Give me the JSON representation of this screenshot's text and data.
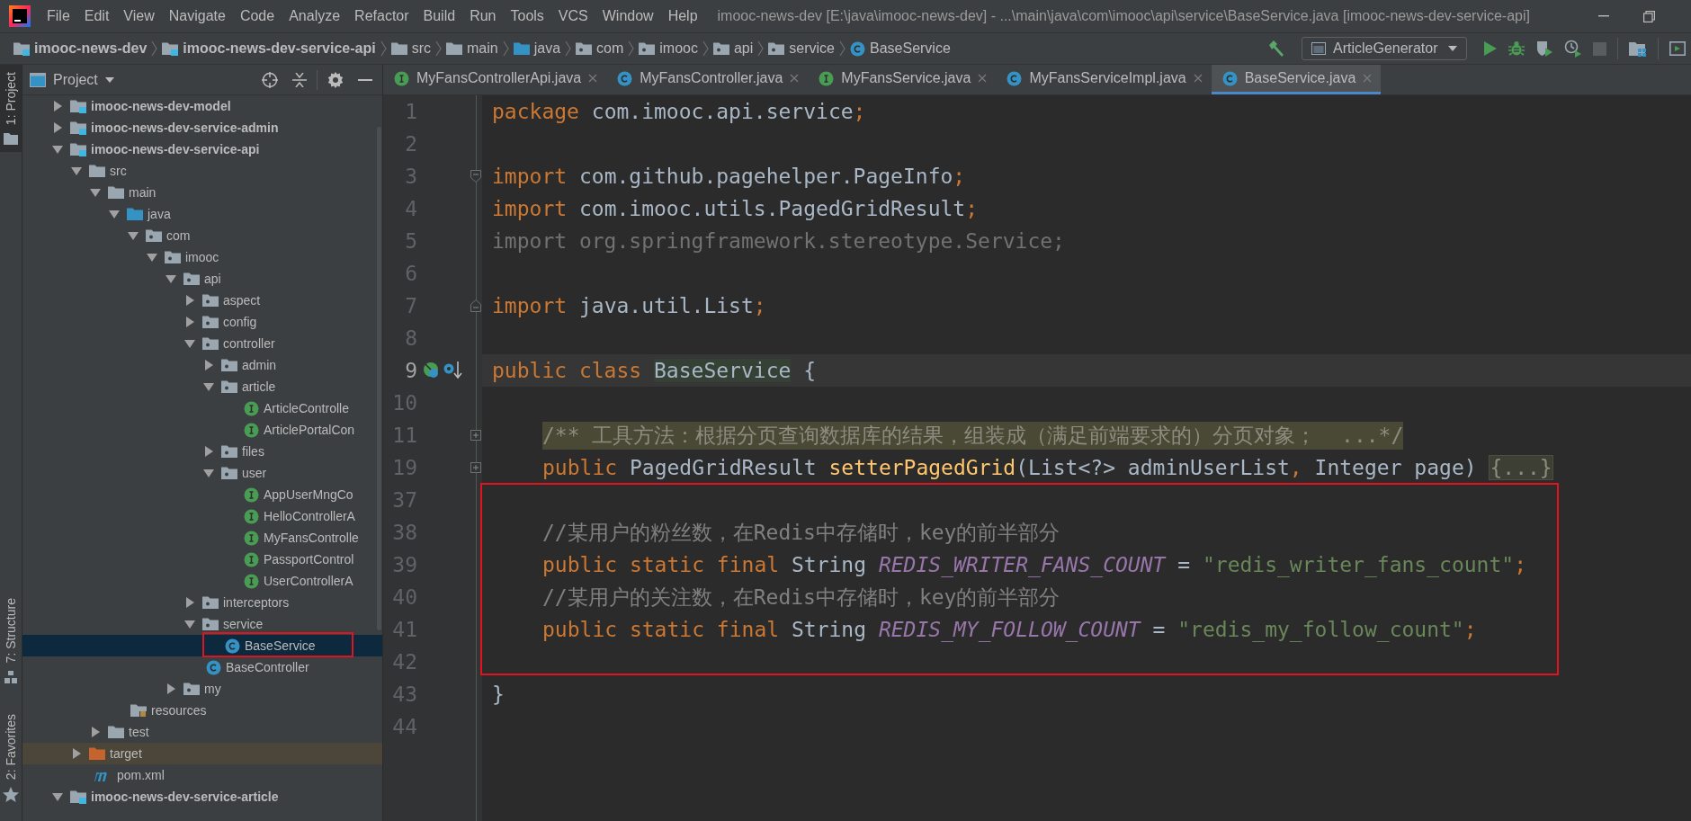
{
  "menu": {
    "items": [
      "File",
      "Edit",
      "View",
      "Navigate",
      "Code",
      "Analyze",
      "Refactor",
      "Build",
      "Run",
      "Tools",
      "VCS",
      "Window",
      "Help"
    ],
    "title": "imooc-news-dev [E:\\java\\imooc-news-dev] - ...\\main\\java\\com\\imooc\\api\\service\\BaseService.java [imooc-news-dev-service-api]"
  },
  "navigation": {
    "breadcrumbs": [
      {
        "label": "imooc-news-dev",
        "kind": "module"
      },
      {
        "label": "imooc-news-dev-service-api",
        "kind": "module"
      },
      {
        "label": "src",
        "kind": "folder"
      },
      {
        "label": "main",
        "kind": "folder"
      },
      {
        "label": "java",
        "kind": "source-folder"
      },
      {
        "label": "com",
        "kind": "package"
      },
      {
        "label": "imooc",
        "kind": "package"
      },
      {
        "label": "api",
        "kind": "package"
      },
      {
        "label": "service",
        "kind": "package"
      },
      {
        "label": "BaseService",
        "kind": "class"
      }
    ],
    "run_configuration": "ArticleGenerator"
  },
  "tool_strip": [
    {
      "label": "1: Project",
      "kind": "top",
      "selected": true
    },
    {
      "label": "7: Structure",
      "kind": "bottom",
      "selected": false
    },
    {
      "label": "2: Favorites",
      "kind": "bottom",
      "selected": false
    }
  ],
  "project": {
    "title": "Project",
    "tree": [
      {
        "label": "imooc-news-dev-model",
        "kind": "module",
        "expanded": false,
        "selected": false
      },
      {
        "label": "imooc-news-dev-service-admin",
        "kind": "module",
        "expanded": false,
        "selected": false
      },
      {
        "label": "imooc-news-dev-service-api",
        "kind": "module",
        "expanded": true,
        "selected": false,
        "children": [
          {
            "label": "src",
            "kind": "folder",
            "expanded": true,
            "selected": false,
            "children": [
              {
                "label": "main",
                "kind": "folder",
                "expanded": true,
                "selected": false,
                "children": [
                  {
                    "label": "java",
                    "kind": "source-folder",
                    "expanded": true,
                    "selected": false,
                    "children": [
                      {
                        "label": "com",
                        "kind": "package",
                        "expanded": true,
                        "selected": false,
                        "children": [
                          {
                            "label": "imooc",
                            "kind": "package",
                            "expanded": true,
                            "selected": false,
                            "children": [
                              {
                                "label": "api",
                                "kind": "package",
                                "expanded": true,
                                "selected": false,
                                "children": [
                                  {
                                    "label": "aspect",
                                    "kind": "package",
                                    "expanded": false,
                                    "selected": false
                                  },
                                  {
                                    "label": "config",
                                    "kind": "package",
                                    "expanded": false,
                                    "selected": false
                                  },
                                  {
                                    "label": "controller",
                                    "kind": "package",
                                    "expanded": true,
                                    "selected": false,
                                    "children": [
                                      {
                                        "label": "admin",
                                        "kind": "package",
                                        "expanded": false,
                                        "selected": false
                                      },
                                      {
                                        "label": "article",
                                        "kind": "package",
                                        "expanded": true,
                                        "selected": false,
                                        "children": [
                                          {
                                            "label": "ArticleControlle",
                                            "kind": "interface",
                                            "selected": false
                                          },
                                          {
                                            "label": "ArticlePortalCon",
                                            "kind": "interface",
                                            "selected": false
                                          }
                                        ]
                                      },
                                      {
                                        "label": "files",
                                        "kind": "package",
                                        "expanded": false,
                                        "selected": false
                                      },
                                      {
                                        "label": "user",
                                        "kind": "package",
                                        "expanded": true,
                                        "selected": false,
                                        "children": [
                                          {
                                            "label": "AppUserMngCo",
                                            "kind": "interface",
                                            "selected": false
                                          },
                                          {
                                            "label": "HelloControllerA",
                                            "kind": "interface",
                                            "selected": false
                                          },
                                          {
                                            "label": "MyFansControlle",
                                            "kind": "interface",
                                            "selected": false
                                          },
                                          {
                                            "label": "PassportControl",
                                            "kind": "interface",
                                            "selected": false
                                          },
                                          {
                                            "label": "UserControllerA",
                                            "kind": "interface",
                                            "selected": false
                                          }
                                        ]
                                      }
                                    ]
                                  },
                                  {
                                    "label": "interceptors",
                                    "kind": "package",
                                    "expanded": false,
                                    "selected": false
                                  },
                                  {
                                    "label": "service",
                                    "kind": "package",
                                    "expanded": true,
                                    "selected": false,
                                    "children": [
                                      {
                                        "label": "BaseService",
                                        "kind": "class",
                                        "selected": true
                                      }
                                    ]
                                  },
                                  {
                                    "label": "BaseController",
                                    "kind": "class",
                                    "selected": false
                                  }
                                ]
                              },
                              {
                                "label": "my",
                                "kind": "package",
                                "expanded": false,
                                "selected": false
                              }
                            ]
                          }
                        ]
                      }
                    ]
                  },
                  {
                    "label": "resources",
                    "kind": "resources-folder",
                    "selected": false
                  }
                ]
              },
              {
                "label": "test",
                "kind": "folder",
                "expanded": false,
                "selected": false
              }
            ]
          },
          {
            "label": "target",
            "kind": "excluded-folder",
            "expanded": false,
            "selected": false
          },
          {
            "label": "pom.xml",
            "kind": "maven-file",
            "selected": false
          }
        ]
      },
      {
        "label": "imooc-news-dev-service-article",
        "kind": "module",
        "expanded": true,
        "selected": false
      }
    ]
  },
  "editor": {
    "tabs": [
      {
        "label": "MyFansControllerApi.java",
        "kind": "interface",
        "selected": false
      },
      {
        "label": "MyFansController.java",
        "kind": "class",
        "selected": false
      },
      {
        "label": "MyFansService.java",
        "kind": "interface",
        "selected": false
      },
      {
        "label": "MyFansServiceImpl.java",
        "kind": "class",
        "selected": false
      },
      {
        "label": "BaseService.java",
        "kind": "class",
        "selected": true
      }
    ],
    "lines": [
      {
        "number": "1",
        "current": false,
        "tokens": [
          {
            "kind": "keyword",
            "text": "package"
          },
          {
            "kind": "plain",
            "text": " com.imooc.api.service"
          },
          {
            "kind": "keyword",
            "text": ";"
          }
        ]
      },
      {
        "number": "2",
        "current": false
      },
      {
        "number": "3",
        "current": false,
        "fold": {
          "kind": "start"
        },
        "tokens": [
          {
            "kind": "keyword",
            "text": "import"
          },
          {
            "kind": "plain",
            "text": " com.github.pagehelper.PageInfo"
          },
          {
            "kind": "keyword",
            "text": ";"
          }
        ]
      },
      {
        "number": "4",
        "current": false,
        "tokens": [
          {
            "kind": "keyword",
            "text": "import"
          },
          {
            "kind": "plain",
            "text": " com.imooc.utils.PagedGridResult"
          },
          {
            "kind": "keyword",
            "text": ";"
          }
        ]
      },
      {
        "number": "5",
        "current": false,
        "tokens": [
          {
            "kind": "unused",
            "text": "import org.springframework.stereotype.Service;"
          }
        ]
      },
      {
        "number": "6",
        "current": false
      },
      {
        "number": "7",
        "current": false,
        "fold": {
          "kind": "end"
        },
        "tokens": [
          {
            "kind": "keyword",
            "text": "import"
          },
          {
            "kind": "plain",
            "text": " java.util.List"
          },
          {
            "kind": "keyword",
            "text": ";"
          }
        ]
      },
      {
        "number": "8",
        "current": false
      },
      {
        "number": "9",
        "current": true,
        "marker": true,
        "tokens": [
          {
            "kind": "keyword",
            "text": "public class "
          },
          {
            "kind": "declaration",
            "text": "BaseService"
          },
          {
            "kind": "plain",
            "text": " {"
          }
        ]
      },
      {
        "number": "10",
        "current": false
      },
      {
        "number": "11",
        "current": false,
        "indented": true,
        "fold": {
          "kind": "collapsed"
        },
        "tokens": [
          {
            "kind": "folded-doc",
            "text": "/** 工具方法：根据分页查询数据库的结果，组装成（满足前端要求的）分页对象；  ...*/"
          }
        ]
      },
      {
        "number": "19",
        "current": false,
        "indented": true,
        "fold": {
          "kind": "collapsed"
        },
        "tokens": [
          {
            "kind": "keyword",
            "text": "public"
          },
          {
            "kind": "plain",
            "text": " PagedGridResult "
          },
          {
            "kind": "method",
            "text": "setterPagedGrid"
          },
          {
            "kind": "plain",
            "text": "(List<?> adminUserList"
          },
          {
            "kind": "keyword",
            "text": ","
          },
          {
            "kind": "plain",
            "text": " Integer page) "
          },
          {
            "kind": "placeholder",
            "text": "{...}"
          }
        ]
      },
      {
        "number": "37",
        "current": false
      },
      {
        "number": "38",
        "current": false,
        "indented": true,
        "tokens": [
          {
            "kind": "comment",
            "text": "//某用户的粉丝数，在Redis中存储时，key的前半部分"
          }
        ]
      },
      {
        "number": "39",
        "current": false,
        "indented": true,
        "tokens": [
          {
            "kind": "keyword",
            "text": "public static final"
          },
          {
            "kind": "plain",
            "text": " String "
          },
          {
            "kind": "constant",
            "text": "REDIS_WRITER_FANS_COUNT"
          },
          {
            "kind": "plain",
            "text": " = "
          },
          {
            "kind": "string",
            "text": "\"redis_writer_fans_count\""
          },
          {
            "kind": "keyword",
            "text": ";"
          }
        ]
      },
      {
        "number": "40",
        "current": false,
        "indented": true,
        "tokens": [
          {
            "kind": "comment",
            "text": "//某用户的关注数，在Redis中存储时，key的前半部分"
          }
        ]
      },
      {
        "number": "41",
        "current": false,
        "indented": true,
        "tokens": [
          {
            "kind": "keyword",
            "text": "public static final"
          },
          {
            "kind": "plain",
            "text": " String "
          },
          {
            "kind": "constant",
            "text": "REDIS_MY_FOLLOW_COUNT"
          },
          {
            "kind": "plain",
            "text": " = "
          },
          {
            "kind": "string",
            "text": "\"redis_my_follow_count\""
          },
          {
            "kind": "keyword",
            "text": ";"
          }
        ]
      },
      {
        "number": "42",
        "current": false
      },
      {
        "number": "43",
        "current": false,
        "tokens": [
          {
            "kind": "plain",
            "text": "}"
          }
        ]
      },
      {
        "number": "44",
        "current": false
      }
    ]
  }
}
